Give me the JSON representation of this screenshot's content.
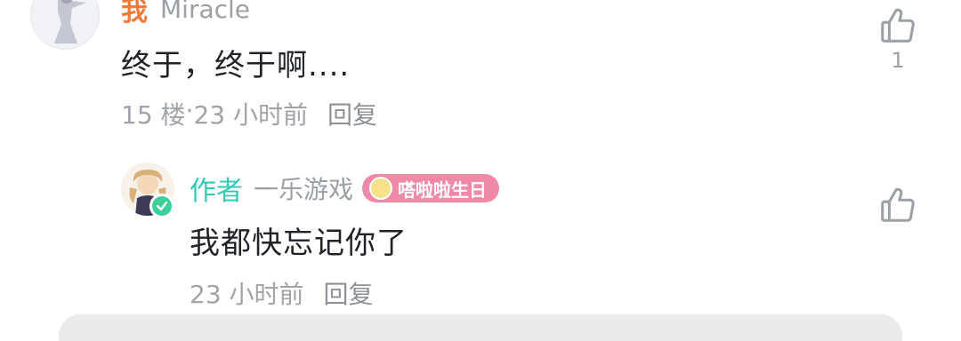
{
  "comment1": {
    "tag": "我",
    "username": "Miracle",
    "content": "终于，终于啊....",
    "floor": "15 楼",
    "separator": " · ",
    "time": "23 小时前",
    "reply_label": "回复",
    "like_count": "1",
    "like_icon": "thumbs-up-icon"
  },
  "comment2": {
    "tag": "作者",
    "username": "一乐游戏",
    "badge_label": "嗒啦啦生日",
    "content": "我都快忘记你了",
    "time": "23 小时前",
    "reply_label": "回复",
    "like_icon": "thumbs-up-icon"
  },
  "colors": {
    "me_tag": "#f0793c",
    "author_tag": "#35c8b4",
    "badge_bg": "#ef8aa6",
    "verified": "#3ccf9a"
  }
}
